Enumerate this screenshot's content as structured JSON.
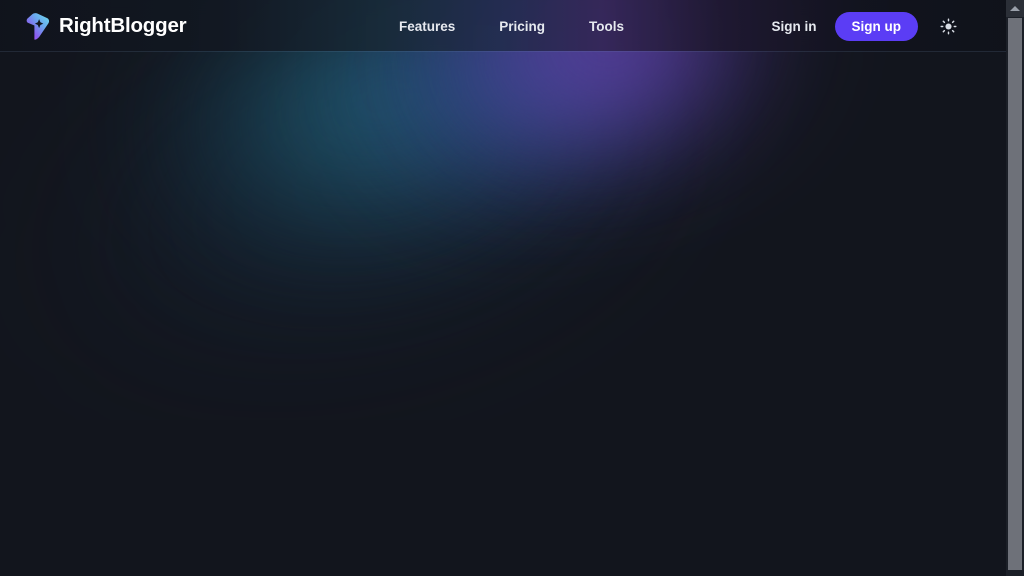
{
  "page": {
    "background_color": "#12151d",
    "theme": "dark"
  },
  "header": {
    "brand": {
      "name": "RightBlogger",
      "logo_icon": "rightblogger-gem-icon",
      "gradient_from": "#7b5cf0",
      "gradient_to": "#5ad6e8"
    },
    "nav_items": [
      {
        "label": "Features",
        "name": "features"
      },
      {
        "label": "Pricing",
        "name": "pricing"
      },
      {
        "label": "Tools",
        "name": "tools"
      }
    ],
    "actions": {
      "signin_label": "Sign in",
      "signup_label": "Sign up",
      "signup_color": "#5b3df5",
      "theme_toggle_icon": "sun-icon"
    },
    "border_color": "#2a3546"
  },
  "hero": {
    "glow_colors": {
      "teal": "#26768c",
      "blue": "#3a60a8",
      "purple": "#7448be"
    }
  },
  "scrollbar": {
    "track_color": "#1b1f27",
    "thumb_color": "#6e7179",
    "up_arrow_icon": "triangle-up-icon"
  }
}
